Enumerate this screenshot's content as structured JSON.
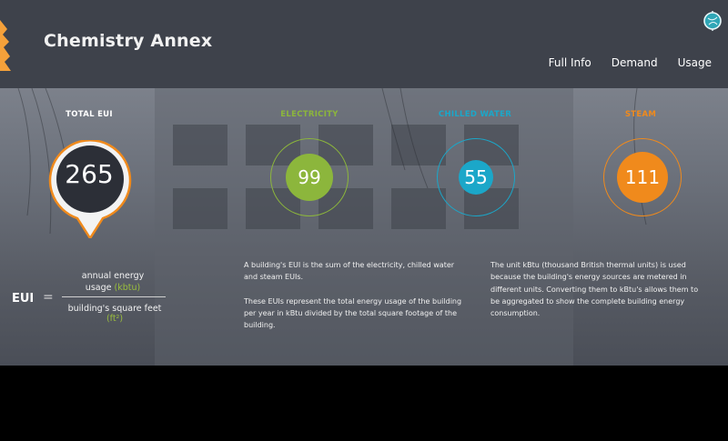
{
  "header": {
    "title": "Chemistry Annex",
    "nav": [
      "Full Info",
      "Demand",
      "Usage"
    ]
  },
  "metrics": {
    "total": {
      "label": "TOTAL EUI",
      "value": "265"
    },
    "electricity": {
      "label": "ELECTRICITY",
      "value": "99",
      "color": "#8cb63c"
    },
    "chilled_water": {
      "label": "CHILLED WATER",
      "value": "55",
      "color": "#1ba7c9"
    },
    "steam": {
      "label": "STEAM",
      "value": "111",
      "color": "#f08a1c"
    }
  },
  "formula": {
    "lhs": "EUI",
    "equals": "=",
    "numerator_line1": "annual energy",
    "numerator_line2": "usage",
    "numerator_unit": "(kbtu)",
    "denominator": "building's square feet",
    "denominator_unit": "(ft²)"
  },
  "text": {
    "para1": "A building's EUI is the sum of the electricity, chilled water and steam EUIs.",
    "para2": "These EUIs represent the total energy usage of the building per year in kBtu divided by the total square footage of the building.",
    "para3": "The unit kBtu (thousand British thermal units) is used because the building's energy sources are metered in different units. Converting them to kBtu's allows them to be aggregated to show the complete building energy consumption."
  }
}
